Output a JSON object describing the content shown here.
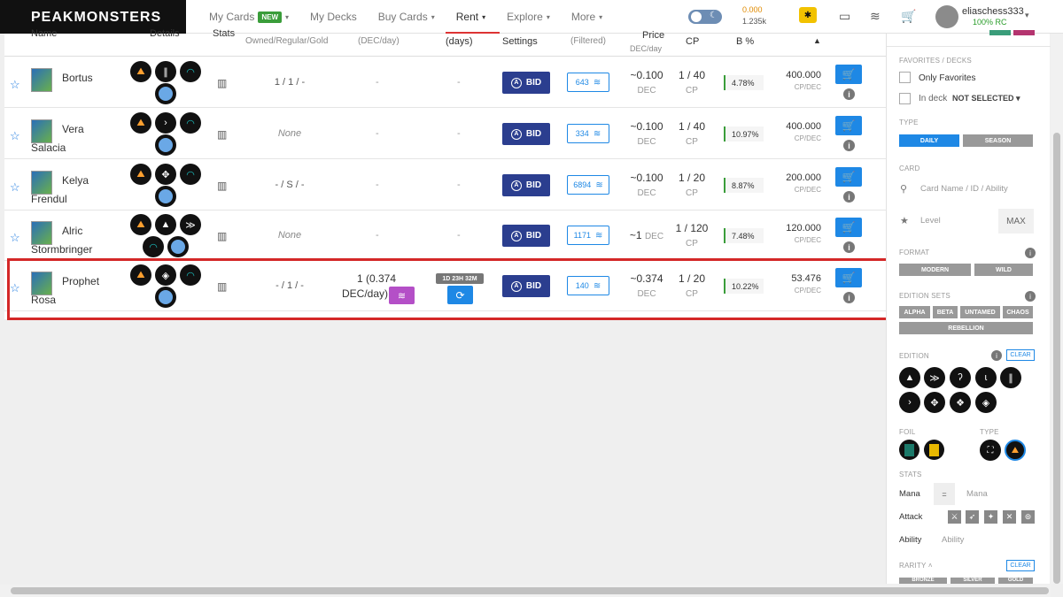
{
  "brand": "PEAKMONSTERS",
  "nav": [
    {
      "label": "My Cards",
      "badge": "NEW"
    },
    {
      "label": "My Decks"
    },
    {
      "label": "Buy Cards"
    },
    {
      "label": "Rent"
    },
    {
      "label": "Explore"
    },
    {
      "label": "More"
    }
  ],
  "balances": {
    "dec": "0.000",
    "sps": "1.235k"
  },
  "user": {
    "name": "eliaschess333",
    "rc": "100% RC"
  },
  "header": {
    "name": "Name",
    "details": "Details",
    "stats": "Stats",
    "owned": "Owned/Regular/Gold",
    "rate": "(DEC/day)",
    "days": "(days)",
    "settings": "Settings",
    "filtered": "(Filtered)",
    "price": "Price",
    "price_unit": "DEC/day",
    "cp": "CP",
    "bonus": "B %",
    "sort": "▲"
  },
  "rows": [
    {
      "name1": "Bortus",
      "name2": "",
      "owned": "1 / 1 / -",
      "rate": "-",
      "days": "-",
      "bid": "BID",
      "avail": "643",
      "price": "~0.100",
      "price_unit": "DEC",
      "cp": "1 / 40",
      "cp_unit": "CP",
      "bonus": "4.78%",
      "cpdec": "400.000",
      "cpdec_unit": "CP/DEC"
    },
    {
      "name1": "Vera",
      "name2": "Salacia",
      "owned": "None",
      "rate": "-",
      "days": "-",
      "bid": "BID",
      "avail": "334",
      "price": "~0.100",
      "price_unit": "DEC",
      "cp": "1 / 40",
      "cp_unit": "CP",
      "bonus": "10.97%",
      "cpdec": "400.000",
      "cpdec_unit": "CP/DEC"
    },
    {
      "name1": "Kelya",
      "name2": "Frendul",
      "owned": "- / S / -",
      "rate": "-",
      "days": "-",
      "bid": "BID",
      "avail": "6894",
      "price": "~0.100",
      "price_unit": "DEC",
      "cp": "1 / 20",
      "cp_unit": "CP",
      "bonus": "8.87%",
      "cpdec": "200.000",
      "cpdec_unit": "CP/DEC"
    },
    {
      "name1": "Alric",
      "name2": "Stormbringer",
      "owned": "None",
      "rate": "-",
      "days": "-",
      "bid": "BID",
      "avail": "1171",
      "price": "~1",
      "price_unit": "DEC",
      "cp": "1 / 120",
      "cp_unit": "CP",
      "bonus": "7.48%",
      "cpdec": "120.000",
      "cpdec_unit": "CP/DEC"
    },
    {
      "name1": "Prophet",
      "name2": "Rosa",
      "owned": "- / 1 / -",
      "rate1": "1 (0.374",
      "rate2": "DEC/day)",
      "timer": "1D 23H 32M",
      "bid": "BID",
      "avail": "140",
      "price": "~0.374",
      "price_unit": "DEC",
      "cp": "1 / 20",
      "cp_unit": "CP",
      "bonus": "10.22%",
      "cpdec": "53.476",
      "cpdec_unit": "CP/DEC"
    }
  ],
  "sidebar": {
    "favorites_title": "FAVORITES / DECKS",
    "only_favorites": "Only Favorites",
    "in_deck": "In deck",
    "in_deck_value": "NOT SELECTED",
    "type_title": "TYPE",
    "type_daily": "DAILY",
    "type_season": "SEASON",
    "card_title": "CARD",
    "card_placeholder": "Card Name / ID / Ability",
    "level_placeholder": "Level",
    "max": "MAX",
    "format_title": "FORMAT",
    "format_modern": "MODERN",
    "format_wild": "WILD",
    "sets_title": "EDITION SETS",
    "sets": [
      "ALPHA",
      "BETA",
      "UNTAMED",
      "CHAOS",
      "REBELLION"
    ],
    "edition_title": "EDITION",
    "clear": "CLEAR",
    "foil_title": "FOIL",
    "type2_title": "TYPE",
    "stats_title": "STATS",
    "mana": "Mana",
    "mana_op": "=",
    "mana_placeholder": "Mana",
    "attack": "Attack",
    "ability": "Ability",
    "ability_placeholder": "Ability",
    "rarity_title": "RARITY",
    "rarity": [
      "BRONZE",
      "SILVER",
      "GOLD"
    ]
  }
}
